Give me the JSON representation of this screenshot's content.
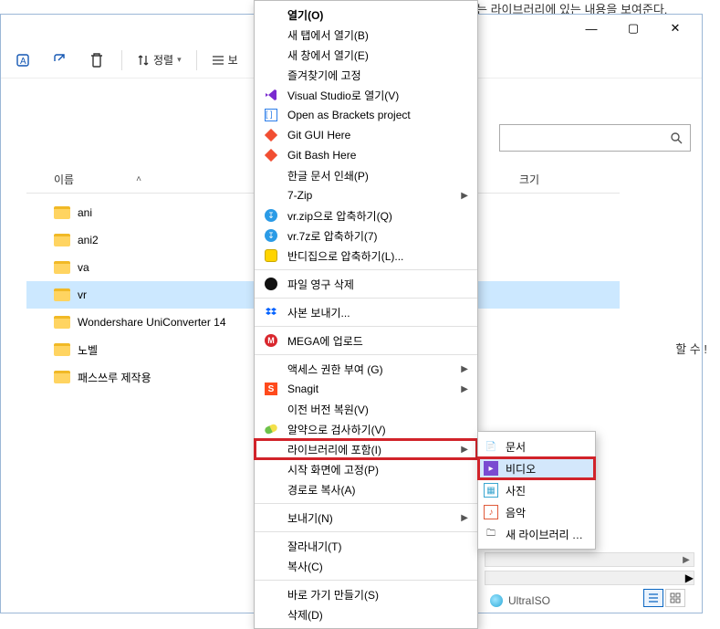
{
  "caption_above": "는 라이브러리에 있는 내용을 보여준다.",
  "window": {
    "controls": {
      "min": "—",
      "max": "▢",
      "close": "✕"
    }
  },
  "toolbar": {
    "sort_label": "정렬",
    "view_label": "보"
  },
  "columns": {
    "name": "이름",
    "size": "크기"
  },
  "files": [
    {
      "name": "ani"
    },
    {
      "name": "ani2"
    },
    {
      "name": "va"
    },
    {
      "name": "vr",
      "selected": true
    },
    {
      "name": "Wondershare UniConverter 14"
    },
    {
      "name": "노벨"
    },
    {
      "name": "패스쓰루 제작용"
    }
  ],
  "right_clip": "할 수 !",
  "context_menu": [
    {
      "label": "열기(O)",
      "bold": true
    },
    {
      "label": "새 탭에서 열기(B)"
    },
    {
      "label": "새 창에서 열기(E)"
    },
    {
      "label": "즐겨찾기에 고정"
    },
    {
      "label": "Visual Studio로 열기(V)",
      "icon": "vs"
    },
    {
      "label": "Open as Brackets project",
      "icon": "brackets"
    },
    {
      "label": "Git GUI Here",
      "icon": "git"
    },
    {
      "label": "Git Bash Here",
      "icon": "git"
    },
    {
      "label": "한글 문서 인쇄(P)"
    },
    {
      "label": "7-Zip",
      "submenu": true
    },
    {
      "label": "vr.zip으로 압축하기(Q)",
      "icon": "bandiblue"
    },
    {
      "label": "vr.7z로 압축하기(7)",
      "icon": "bandiblue"
    },
    {
      "label": "반디집으로 압축하기(L)...",
      "icon": "bandi"
    },
    {
      "sep": true
    },
    {
      "label": "파일 영구 삭제",
      "icon": "blackcircle"
    },
    {
      "sep": true
    },
    {
      "label": "사본 보내기...",
      "icon": "dropbox"
    },
    {
      "sep": true
    },
    {
      "label": "MEGA에 업로드",
      "icon": "mega"
    },
    {
      "sep": true
    },
    {
      "label": "액세스 권한 부여 (G)",
      "submenu": true
    },
    {
      "label": "Snagit",
      "icon": "snagit",
      "submenu": true
    },
    {
      "label": "이전 버전 복원(V)"
    },
    {
      "label": "알약으로 검사하기(V)",
      "icon": "pill"
    },
    {
      "label": "라이브러리에 포함(I)",
      "submenu": true,
      "redbox": true
    },
    {
      "label": "시작 화면에 고정(P)"
    },
    {
      "label": "경로로 복사(A)"
    },
    {
      "sep": true
    },
    {
      "label": "보내기(N)",
      "submenu": true
    },
    {
      "sep": true
    },
    {
      "label": "잘라내기(T)"
    },
    {
      "label": "복사(C)"
    },
    {
      "sep": true
    },
    {
      "label": "바로 가기 만들기(S)"
    },
    {
      "label": "삭제(D)"
    }
  ],
  "submenu": {
    "items": [
      {
        "label": "문서",
        "icon": "doc"
      },
      {
        "label": "비디오",
        "icon": "video",
        "selected": true,
        "redbox": true
      },
      {
        "label": "사진",
        "icon": "photo"
      },
      {
        "label": "음악",
        "icon": "music"
      },
      {
        "label": "새 라이브러리 만들기",
        "icon": "new"
      }
    ]
  },
  "statusbar": {
    "ultraiso": "UltraISO"
  }
}
